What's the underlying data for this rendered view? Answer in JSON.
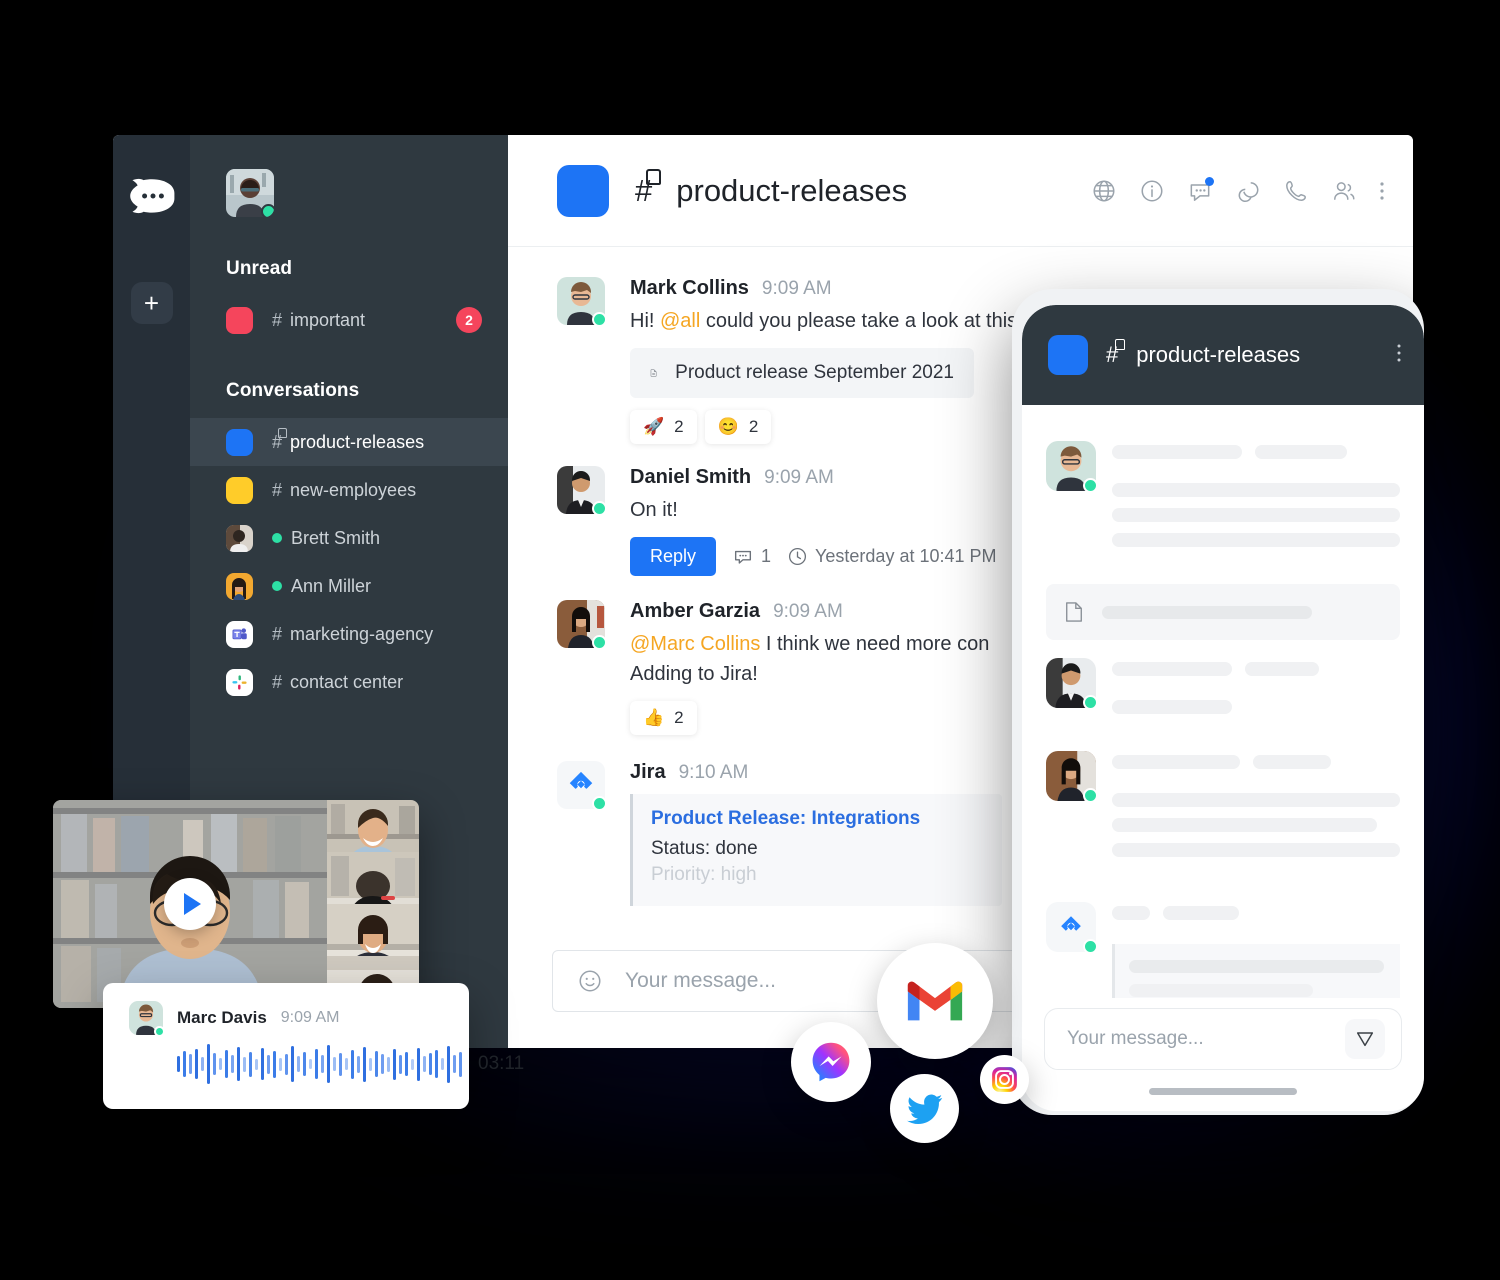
{
  "brand": {
    "logo_icon": "rocket-chat-logo",
    "accent": "#1d74f5",
    "dark_bg": "#2f3940",
    "rail_bg": "#262f38"
  },
  "rail": {
    "add_label": "+",
    "add_icon": "plus-icon"
  },
  "sidebar": {
    "profile": {
      "avatar_icon": "user-avatar",
      "status": "online"
    },
    "sections": [
      {
        "title": "Unread",
        "items": [
          {
            "label": "important",
            "icon": "hash-icon",
            "swatch": "#f5455c",
            "badge": "2",
            "locked": false,
            "type": "channel"
          }
        ]
      },
      {
        "title": "Conversations",
        "items": [
          {
            "label": "product-releases",
            "icon": "hash-lock-icon",
            "swatch": "#1d74f5",
            "badge": "",
            "locked": true,
            "type": "channel",
            "active": true
          },
          {
            "label": "new-employees",
            "icon": "hash-icon",
            "swatch": "#ffcc29",
            "badge": "",
            "locked": false,
            "type": "channel"
          },
          {
            "label": "Brett Smith",
            "icon": "presence-dot-icon",
            "swatch": "avatar-brett",
            "badge": "",
            "locked": false,
            "type": "dm"
          },
          {
            "label": "Ann Miller",
            "icon": "presence-dot-icon",
            "swatch": "avatar-ann",
            "badge": "",
            "locked": false,
            "type": "dm"
          },
          {
            "label": "marketing-agency",
            "icon": "hash-icon",
            "swatch": "ms-teams-icon",
            "badge": "",
            "locked": false,
            "type": "channel"
          },
          {
            "label": "contact center",
            "icon": "hash-icon",
            "swatch": "slack-icon",
            "badge": "",
            "locked": false,
            "type": "channel"
          }
        ]
      }
    ]
  },
  "chat_header": {
    "room_name": "product-releases",
    "hash": "#",
    "icons": [
      "globe-icon",
      "info-icon",
      "discussion-icon",
      "threads-icon",
      "phone-icon",
      "team-icon",
      "kebab-menu-icon"
    ],
    "discussion_has_badge": true
  },
  "messages": [
    {
      "user": "Mark Collins",
      "time": "9:09 AM",
      "avatar_icon": "avatar-mark",
      "text_before": "Hi! ",
      "mention": "@all",
      "text_after": " could you please take a look at this",
      "attachment": {
        "icon": "document-icon",
        "label": "Product release September 2021"
      },
      "reactions": [
        {
          "emoji": "🚀",
          "count": "2"
        },
        {
          "emoji": "😊",
          "count": "2"
        }
      ]
    },
    {
      "user": "Daniel Smith",
      "time": "9:09 AM",
      "avatar_icon": "avatar-daniel",
      "text_before": "On it!",
      "mention": "",
      "text_after": "",
      "actions": {
        "reply_label": "Reply",
        "thread_icon": "thread-icon",
        "thread_count": "1",
        "clock_icon": "clock-icon",
        "last_reply": "Yesterday at 10:41 PM"
      }
    },
    {
      "user": "Amber Garzia",
      "time": "9:09 AM",
      "avatar_icon": "avatar-amber",
      "mention": "@Marc Collins",
      "text_after": " I think we need more con",
      "second_line": "Adding to Jira!",
      "reactions": [
        {
          "emoji": "👍",
          "count": "2"
        }
      ]
    },
    {
      "user": "Jira",
      "time": "9:10 AM",
      "avatar_icon": "jira-icon",
      "card": {
        "title": "Product Release: Integrations",
        "status": "Status: done",
        "priority": "Priority: high"
      }
    }
  ],
  "composer": {
    "emoji_icon": "emoji-icon",
    "placeholder": "Your message..."
  },
  "phone": {
    "header": {
      "room_name": "product-releases",
      "hash": "#",
      "kebab_icon": "kebab-menu-icon"
    },
    "messages": [
      {
        "avatar_icon": "avatar-mark",
        "has_attachment": true,
        "attachment_icon": "document-icon"
      },
      {
        "avatar_icon": "avatar-daniel",
        "has_attachment": false
      },
      {
        "avatar_icon": "avatar-amber",
        "has_attachment": false
      },
      {
        "avatar_icon": "jira-icon",
        "has_card": true
      }
    ],
    "composer": {
      "placeholder": "Your message...",
      "send_icon": "send-icon"
    }
  },
  "video_card": {
    "play_icon": "play-icon",
    "tiles": 4
  },
  "audio_card": {
    "user": "Marc Davis",
    "time": "9:09 AM",
    "duration": "03:11",
    "avatar_icon": "avatar-marc",
    "waveform_icon": "waveform-icon"
  },
  "social_bubbles": [
    {
      "name": "gmail-icon",
      "label": "Gmail"
    },
    {
      "name": "messenger-icon",
      "label": "Messenger"
    },
    {
      "name": "twitter-icon",
      "label": "Twitter"
    },
    {
      "name": "instagram-icon",
      "label": "Instagram"
    }
  ]
}
